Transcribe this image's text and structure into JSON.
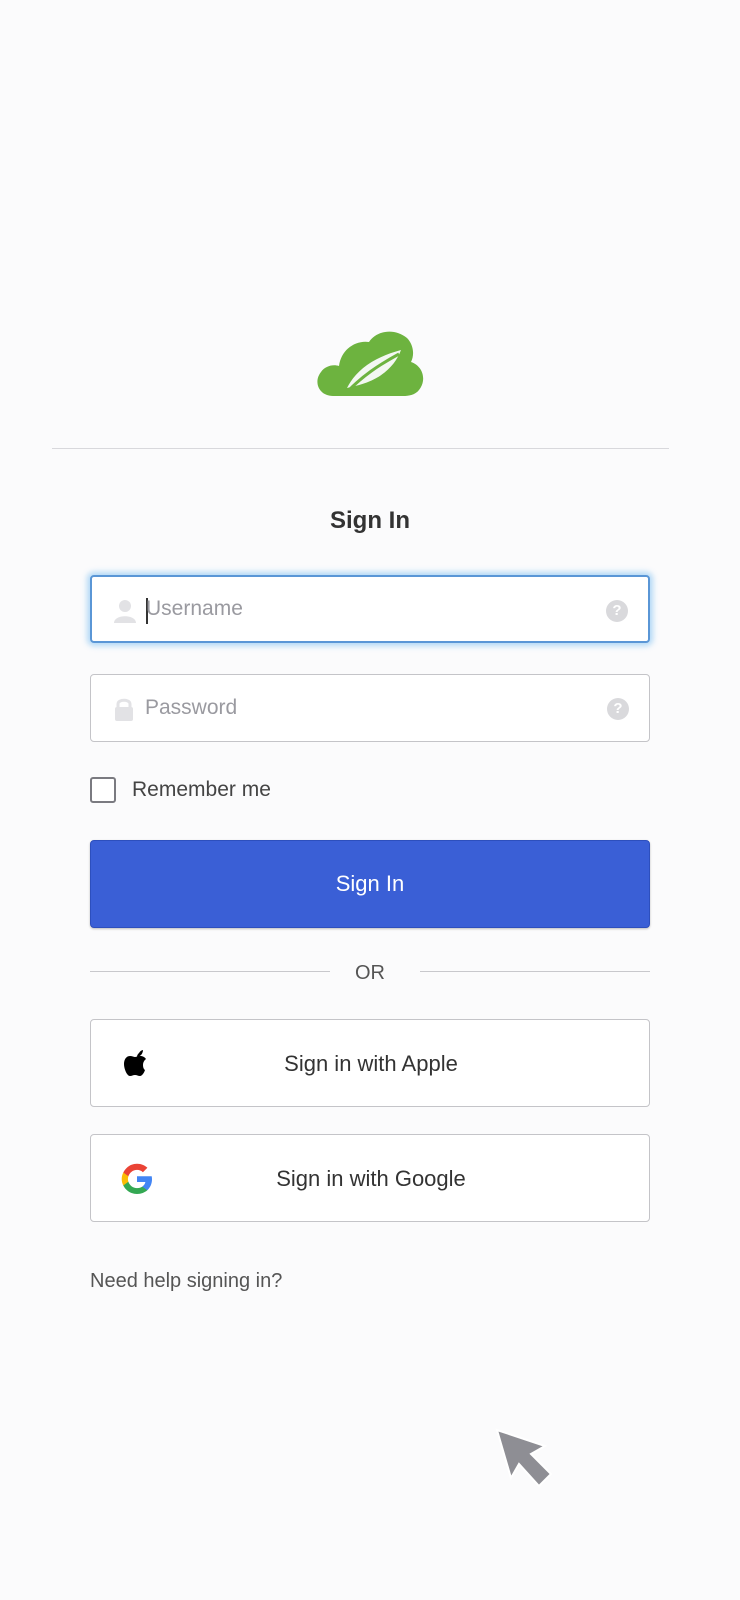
{
  "brand": {
    "logo_icon": "spring-cloud-leaf-icon",
    "color": "#6db33f"
  },
  "form": {
    "title": "Sign In",
    "username": {
      "placeholder": "Username",
      "value": "",
      "icon": "user-icon",
      "help_icon": "question-icon"
    },
    "password": {
      "placeholder": "Password",
      "value": "",
      "icon": "lock-icon",
      "help_icon": "question-icon"
    },
    "remember_label": "Remember me",
    "remember_checked": false,
    "submit_label": "Sign In",
    "submit_color": "#3a5fd6",
    "separator": "OR",
    "apple_label": "Sign in with Apple",
    "google_label": "Sign in with Google",
    "help_link": "Need help signing in?"
  }
}
